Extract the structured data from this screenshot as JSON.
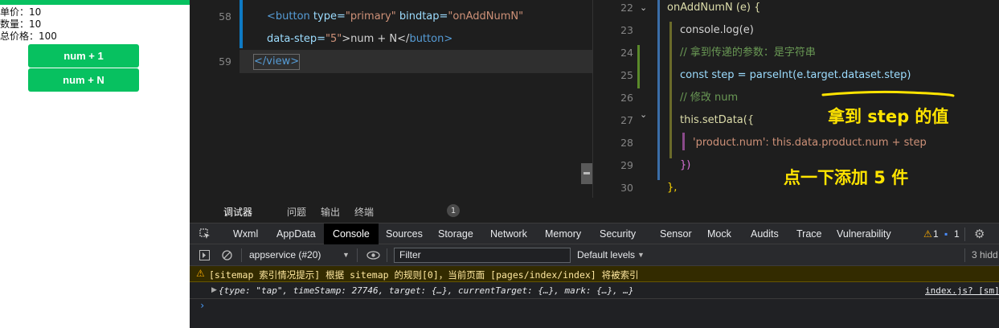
{
  "simulator": {
    "unit_price": "单价：10",
    "quantity": "数量：10",
    "total_price": "总价格：100",
    "buttons": [
      "num + 1",
      "num + N"
    ],
    "accent": "#07c160"
  },
  "left_editor": {
    "line_numbers": [
      "58",
      "59"
    ],
    "lines": [
      {
        "tag_open": "<button",
        "attr1": " type=",
        "val1": "\"primary\"",
        "attr2": " bindtap=",
        "val2": "\"onAddNumN\""
      },
      {
        "attr": "data-step=",
        "val": "\"5\"",
        "rest": ">num + N</",
        "close": "button>"
      },
      {
        "text": "</view>"
      }
    ]
  },
  "right_editor": {
    "line_numbers": [
      "22",
      "23",
      "24",
      "25",
      "26",
      "27",
      "28",
      "29",
      "30"
    ],
    "lines": [
      "onAddNumN (e) {",
      "console.log(e)",
      "// 拿到传递的参数：是字符串",
      "const step = parseInt(e.target.dataset.step)",
      "// 修改 num",
      "this.setData({",
      "'product.num': this.data.product.num + step",
      "})",
      "},"
    ],
    "annotations": [
      "拿到 step 的值",
      "点一下添加 5 件"
    ],
    "annotation_color": "#ffe400"
  },
  "devtools": {
    "header_tabs": [
      "调试器",
      "问题",
      "输出",
      "终端"
    ],
    "debugger_badge": "1",
    "panel_tabs": [
      "Wxml",
      "AppData",
      "Console",
      "Sources",
      "Storage",
      "Network",
      "Memory",
      "Security",
      "Sensor",
      "Mock",
      "Audits",
      "Trace",
      "Vulnerability"
    ],
    "active_panel": "Console",
    "warn_count": "1",
    "info_count": "1",
    "context": "appservice (#20)",
    "filter_placeholder": "Filter",
    "levels": "Default levels",
    "hidden": "3 hidd",
    "warning_message": "[sitemap 索引情况提示] 根据 sitemap 的规则[0]，当前页面 [pages/index/index] 将被索引",
    "log_message": "{type: \"tap\", timeStamp: 27746, target: {…}, currentTarget: {…}, mark: {…}, …}",
    "log_source": "index.js? [sm]",
    "prompt": "›"
  }
}
